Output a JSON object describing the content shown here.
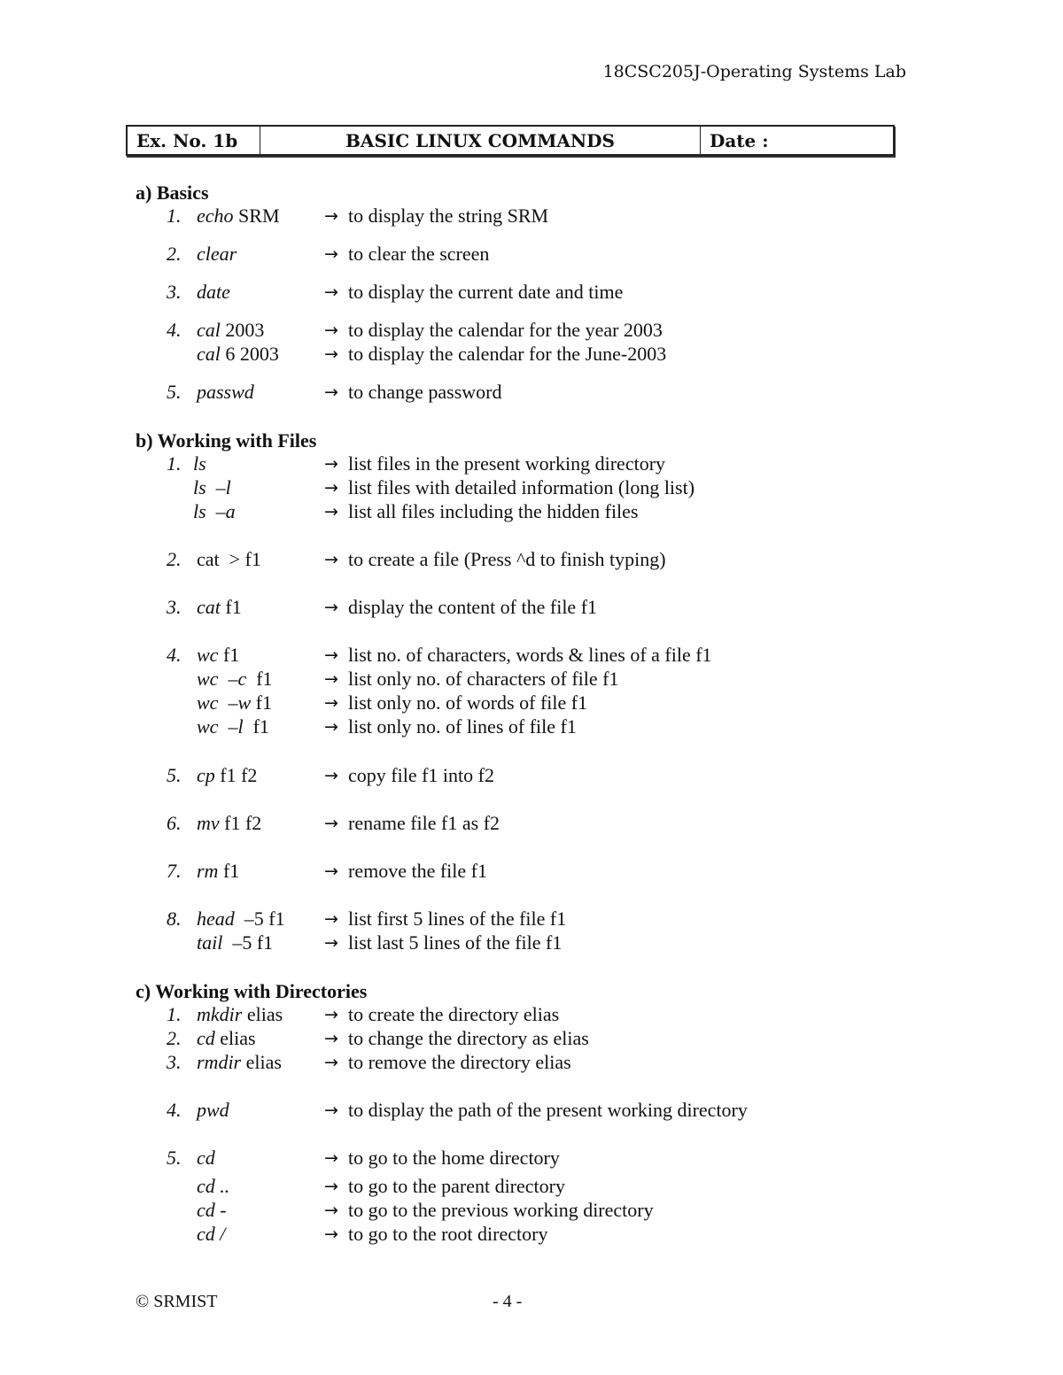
{
  "header": {
    "course": "18CSC205J-Operating Systems Lab"
  },
  "title_box": {
    "ex_no": "Ex. No. 1b",
    "title": "BASIC LINUX COMMANDS",
    "date_label": "Date :"
  },
  "arrow_glyph": "→",
  "sections": [
    {
      "heading": "a) Basics",
      "rows": [
        {
          "num": "1.",
          "cmd": "echo",
          "args": " SRM",
          "desc": "to display the string SRM"
        },
        {
          "num": "2.",
          "cmd": "clear",
          "args": "",
          "desc": "to clear the screen"
        },
        {
          "num": "3.",
          "cmd": "date",
          "args": "",
          "desc": "to display the current date and time"
        },
        {
          "num": "4.",
          "cmd": "cal",
          "args": " 2003",
          "desc": "to display the calendar for the year 2003"
        },
        {
          "num": "",
          "cmd": "cal",
          "args": " 6 2003",
          "desc": "to display the calendar for the June-2003"
        },
        {
          "num": "5.",
          "cmd": "passwd",
          "args": "",
          "desc": "to change password"
        }
      ]
    },
    {
      "heading": "b) Working with Files",
      "rows": [
        {
          "num": "1.",
          "cmd": "ls",
          "args": "",
          "desc": "list files in the present working directory"
        },
        {
          "num": "",
          "cmd": "ls  –l",
          "args": "",
          "desc": "list files with detailed information (long list)"
        },
        {
          "num": "",
          "cmd": "ls  –a",
          "args": "",
          "desc": "list all files including the hidden files"
        },
        {
          "num": "2.",
          "cmd": "",
          "args": "cat  > f1",
          "desc": "to create a file  (Press ^d to finish typing)"
        },
        {
          "num": "3.",
          "cmd": "cat",
          "args": " f1",
          "desc": "display the content of the file f1"
        },
        {
          "num": "4.",
          "cmd": "wc",
          "args": " f1",
          "desc": "list no. of characters, words & lines of a file f1"
        },
        {
          "num": "",
          "cmd": "wc  –c",
          "args": "  f1",
          "desc": "list only no. of characters of file f1"
        },
        {
          "num": "",
          "cmd": "wc  –w",
          "args": " f1",
          "desc": "list only no. of words of file f1"
        },
        {
          "num": "",
          "cmd": "wc  –l",
          "args": "  f1",
          "desc": "list only no. of lines of file f1"
        },
        {
          "num": "5.",
          "cmd": "cp",
          "args": " f1 f2",
          "desc": "copy file f1 into f2"
        },
        {
          "num": "6.",
          "cmd": "mv",
          "args": " f1 f2",
          "desc": "rename file f1 as f2"
        },
        {
          "num": "7.",
          "cmd": "rm",
          "args": " f1",
          "desc": "remove the file f1"
        },
        {
          "num": "8.",
          "cmd": "head",
          "args": "  –5 f1",
          "desc": "list first 5 lines of the file f1"
        },
        {
          "num": "",
          "cmd": "tail",
          "args": "  –5 f1",
          "desc": "list last 5 lines of the file f1"
        }
      ]
    },
    {
      "heading": "c) Working with Directories",
      "rows": [
        {
          "num": "1.",
          "cmd": "mkdir",
          "args": " elias",
          "desc": "to create the directory elias"
        },
        {
          "num": "2.",
          "cmd": "cd",
          "args": " elias",
          "desc": "to change the directory as elias"
        },
        {
          "num": "3.",
          "cmd": "rmdir",
          "args": " elias",
          "desc": "to remove the directory elias"
        },
        {
          "num": "4.",
          "cmd": "pwd",
          "args": "",
          "desc": "to display the path of the present working directory"
        },
        {
          "num": "5.",
          "cmd": "cd",
          "args": "",
          "desc": "to go to the home directory"
        },
        {
          "num": "",
          "cmd": "cd ..",
          "args": "",
          "desc": "to go to the parent directory"
        },
        {
          "num": "",
          "cmd": "cd -",
          "args": "",
          "desc": "to go to the previous working directory"
        },
        {
          "num": "",
          "cmd": "cd /",
          "args": "",
          "desc": "to go to the root directory"
        }
      ]
    }
  ],
  "footer": {
    "copyright": "© SRMIST",
    "page": "- 4 -"
  }
}
